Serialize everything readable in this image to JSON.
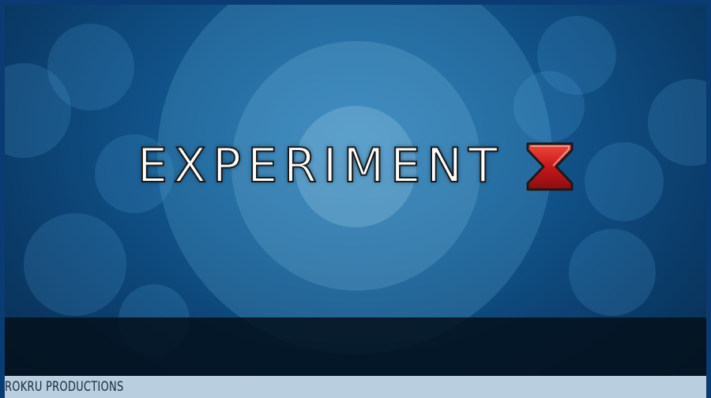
{
  "title": {
    "main_text": "EXPERIMENT",
    "logo_mark_icon": "red-hourglass-x-icon",
    "logo_color": "#c8171b"
  },
  "footer": {
    "label": "ROKRU PRODUCTIONS",
    "strip_color": "#b9cfe0"
  },
  "background": {
    "accent": "#1c6fae",
    "dark": "#072a4c"
  }
}
